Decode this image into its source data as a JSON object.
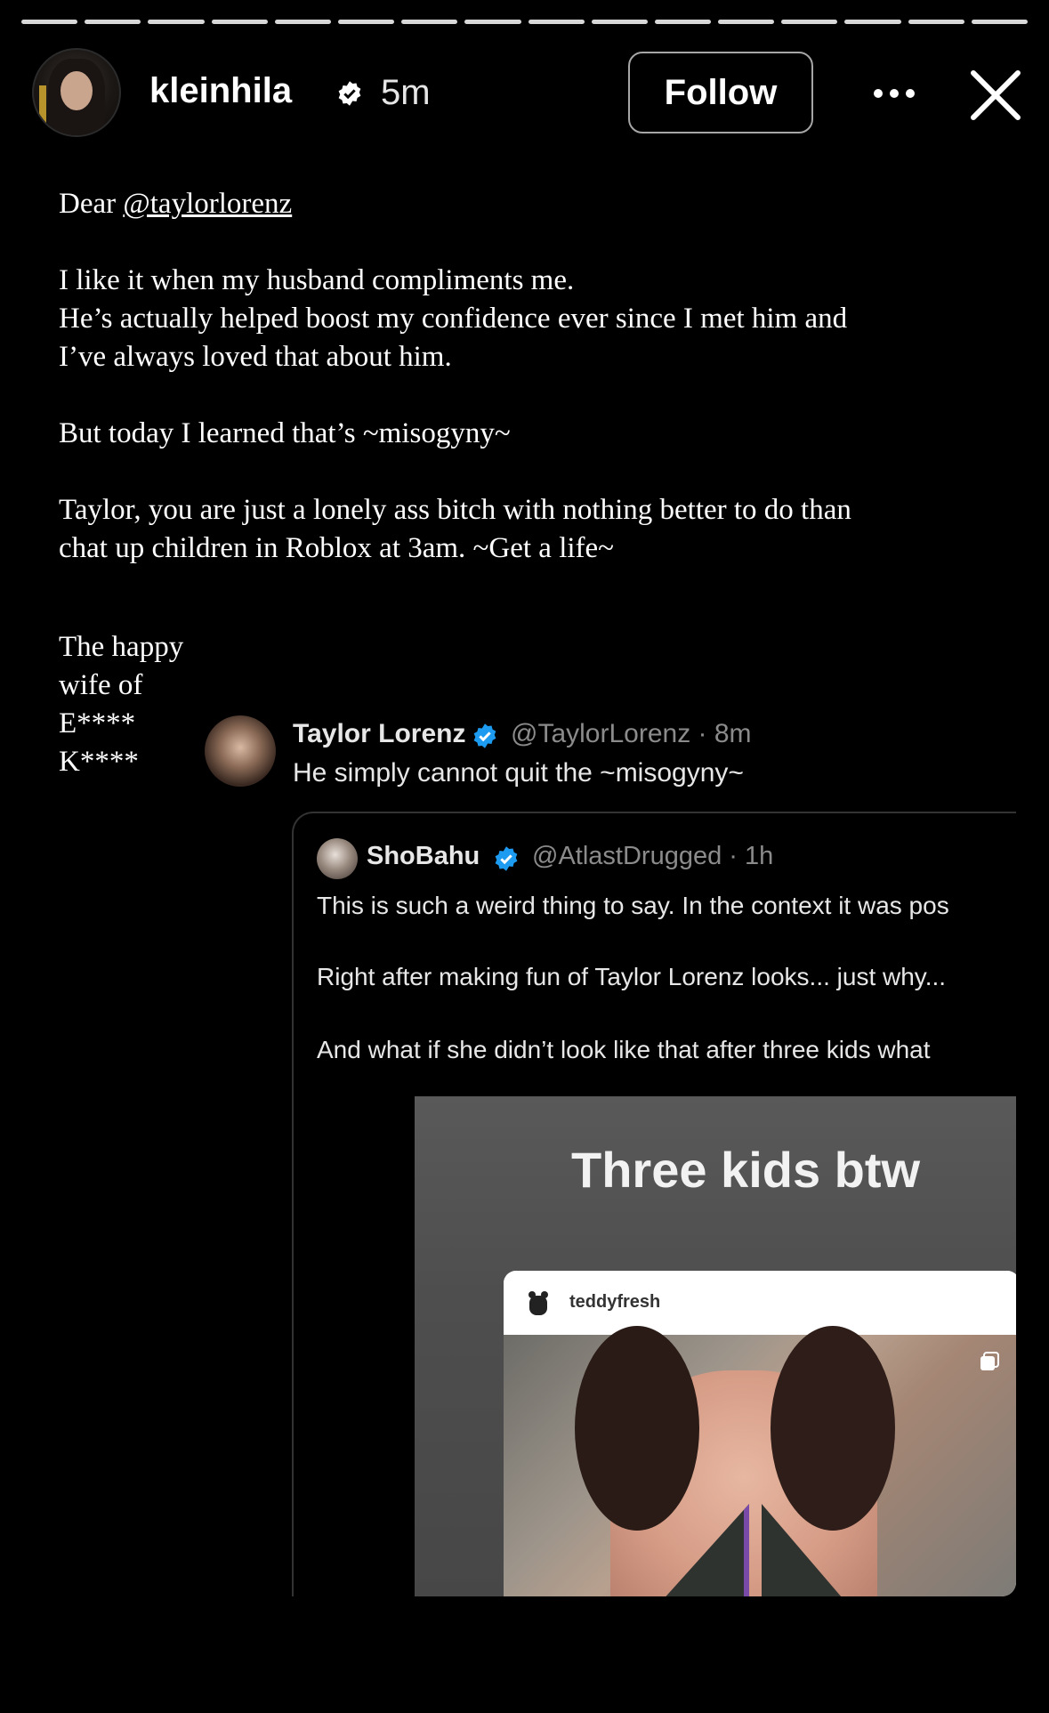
{
  "story": {
    "progress_segments_total": 16,
    "progress_segments_done": 16
  },
  "header": {
    "username": "kleinhila",
    "time": "5m",
    "follow_label": "Follow",
    "icons": [
      "verified-icon",
      "more-icon",
      "close-icon"
    ]
  },
  "post": {
    "greeting": "Dear ",
    "mention": "@taylorlorenz",
    "line1": "I like it when my husband compliments me.",
    "line2": "He’s actually helped boost my confidence ever since I met him and",
    "line3": "I’ve always loved that about him.",
    "line4": "But today I learned that’s ~misogyny~",
    "line5": "Taylor, you are just a lonely ass bitch with nothing better to do than",
    "line6": "chat up children in Roblox at 3am.  ~Get a life~",
    "sig1": "The happy",
    "sig2": "wife of",
    "sig3": "E****",
    "sig4": "K****"
  },
  "tweet": {
    "name": "Taylor Lorenz",
    "handle": "@TaylorLorenz · 8m",
    "text": "He simply cannot quit the ~misogyny~"
  },
  "quote": {
    "name": "ShoBahu",
    "handle": "@AtlastDrugged · 1h",
    "line1": "This is such a weird thing to say. In the context it was pos",
    "line2": "Right after making fun of Taylor Lorenz looks... just why...",
    "line3": "And what if she didn’t look like that after three kids what"
  },
  "embed": {
    "caption": "Three kids btw",
    "ig_username": "teddyfresh"
  },
  "colors": {
    "background": "#000000",
    "verified_blue": "#1d9bf0",
    "muted_text": "#8b8b8b"
  }
}
